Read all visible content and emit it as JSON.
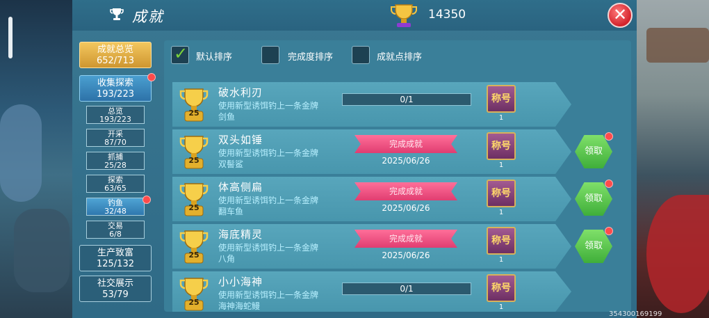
{
  "header": {
    "title": "成就",
    "points": "14350",
    "close_label": "✕"
  },
  "sidebar": {
    "categories": [
      {
        "label": "成就总览",
        "count": "652/713"
      },
      {
        "label": "收集探索",
        "count": "193/223"
      },
      {
        "label": "生产致富",
        "count": "125/132"
      },
      {
        "label": "社交展示",
        "count": "53/79"
      }
    ],
    "sub_items": [
      {
        "label": "总览",
        "count": "193/223"
      },
      {
        "label": "开采",
        "count": "87/70"
      },
      {
        "label": "抓捕",
        "count": "25/28"
      },
      {
        "label": "探索",
        "count": "63/65"
      },
      {
        "label": "钓鱼",
        "count": "32/48"
      },
      {
        "label": "交易",
        "count": "6/8"
      }
    ]
  },
  "sort": {
    "options": [
      "默认排序",
      "完成度排序",
      "成就点排序"
    ],
    "selected": "默认排序"
  },
  "achievements": [
    {
      "name": "破水利刃",
      "desc1": "使用新型诱饵钓上一条金牌",
      "desc2": "剑鱼",
      "points": "25",
      "progress": "0/1",
      "status": "",
      "date": "",
      "badge": "称号",
      "badge_count": "1",
      "claim": ""
    },
    {
      "name": "双头如锤",
      "desc1": "使用新型诱饵钓上一条金牌",
      "desc2": "双髻鲨",
      "points": "25",
      "progress": "",
      "status": "完成成就",
      "date": "2025/06/26",
      "badge": "称号",
      "badge_count": "1",
      "claim": "领取"
    },
    {
      "name": "体高侧扁",
      "desc1": "使用新型诱饵钓上一条金牌",
      "desc2": "翻车鱼",
      "points": "25",
      "progress": "",
      "status": "完成成就",
      "date": "2025/06/26",
      "badge": "称号",
      "badge_count": "1",
      "claim": "领取"
    },
    {
      "name": "海底精灵",
      "desc1": "使用新型诱饵钓上一条金牌",
      "desc2": "八角",
      "points": "25",
      "progress": "",
      "status": "完成成就",
      "date": "2025/06/26",
      "badge": "称号",
      "badge_count": "1",
      "claim": "领取"
    },
    {
      "name": "小小海神",
      "desc1": "使用新型诱饵钓上一条金牌",
      "desc2": "海神海蛇鳗",
      "points": "25",
      "progress": "0/1",
      "status": "",
      "date": "",
      "badge": "称号",
      "badge_count": "1",
      "claim": ""
    }
  ],
  "uid": "354300169199",
  "colors": {
    "panel": "#2f6a86",
    "row": "#4896ad",
    "accent_gold": "#f2c75e",
    "ribbon": "#e03d71",
    "claim": "#3fae3a"
  }
}
